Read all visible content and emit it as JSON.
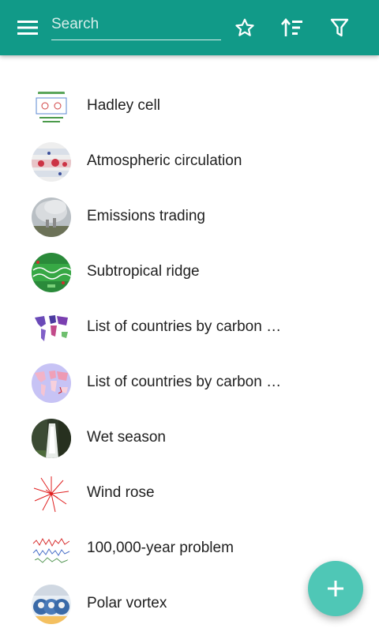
{
  "colors": {
    "app_bar": "#119a88",
    "fab": "#4fc7b6",
    "icon": "#ffffff",
    "item_text": "#212121"
  },
  "toolbar": {
    "menu_icon": "hamburger-menu-icon",
    "search_placeholder": "Search",
    "search_value": "",
    "favorites_icon": "star-outline-icon",
    "sort_icon": "sort-icon",
    "filter_icon": "filter-icon"
  },
  "articles": [
    {
      "title": "Hadley cell",
      "thumbnail": "hadley-cell-diagram"
    },
    {
      "title": "Atmospheric circulation",
      "thumbnail": "circulation-map"
    },
    {
      "title": "Emissions trading",
      "thumbnail": "smokestack-photo"
    },
    {
      "title": "Subtropical ridge",
      "thumbnail": "ridge-map"
    },
    {
      "title": "List of countries by carbon …",
      "thumbnail": "world-map-purple"
    },
    {
      "title": "List of countries by carbon …",
      "thumbnail": "world-map-pink"
    },
    {
      "title": "Wet season",
      "thumbnail": "waterfall-photo"
    },
    {
      "title": "Wind rose",
      "thumbnail": "wind-rose-chart"
    },
    {
      "title": "100,000-year problem",
      "thumbnail": "climate-graph"
    },
    {
      "title": "Polar vortex",
      "thumbnail": "polar-vortex-globes"
    }
  ],
  "fab": {
    "icon": "plus-icon"
  }
}
